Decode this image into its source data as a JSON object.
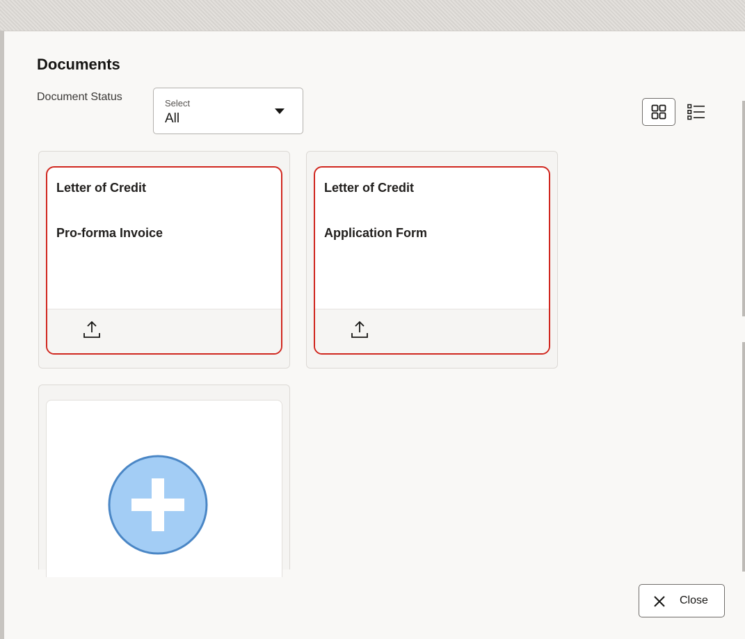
{
  "dialog": {
    "title": "Documents"
  },
  "filter": {
    "label": "Document Status",
    "select_caption": "Select",
    "select_value": "All"
  },
  "view_toggle": {
    "grid_icon": "grid-view-icon",
    "list_icon": "list-view-icon"
  },
  "documents": [
    {
      "category": "Letter of Credit",
      "name": "Pro-forma Invoice",
      "action_icon": "upload-icon"
    },
    {
      "category": "Letter of Credit",
      "name": "Application Form",
      "action_icon": "upload-icon"
    }
  ],
  "add_card": {
    "icon": "add-plus-icon"
  },
  "footer": {
    "close_label": "Close",
    "close_icon": "close-icon"
  },
  "colors": {
    "card_border_error": "#d0261e",
    "add_circle_fill": "#a3cdf5",
    "add_circle_stroke": "#4a86c5"
  }
}
